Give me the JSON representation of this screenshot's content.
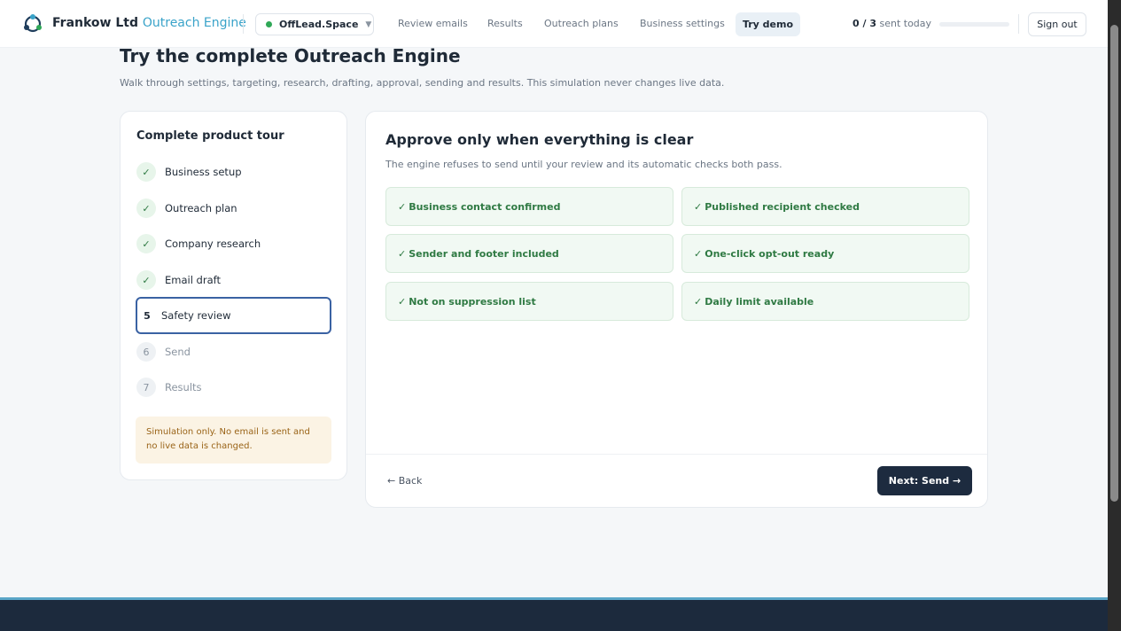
{
  "header": {
    "brand_name": "Frankow Ltd",
    "brand_app": "Outreach Engine",
    "domain": "OffLead.Space",
    "nav": [
      "Review emails",
      "Results",
      "Outreach plans",
      "Business settings"
    ],
    "nav_active": "Try demo",
    "sent_count": "0 / 3",
    "sent_suffix": "sent today",
    "sent_fraction": 0,
    "sign_out": "Sign out",
    "accent_color": "#3aa3c9",
    "status_color": "#2fa857"
  },
  "page": {
    "title": "Try the complete Outreach Engine",
    "subtitle": "Walk through settings, targeting, research, drafting, approval, sending and results. This simulation never changes live data."
  },
  "tour": {
    "title": "Complete product tour",
    "steps": [
      {
        "marker": "✓",
        "label": "Business setup",
        "state": "done"
      },
      {
        "marker": "✓",
        "label": "Outreach plan",
        "state": "done"
      },
      {
        "marker": "✓",
        "label": "Company research",
        "state": "done"
      },
      {
        "marker": "✓",
        "label": "Email draft",
        "state": "done"
      },
      {
        "marker": "5",
        "label": "Safety review",
        "state": "current"
      },
      {
        "marker": "6",
        "label": "Send",
        "state": "pending"
      },
      {
        "marker": "7",
        "label": "Results",
        "state": "pending"
      }
    ],
    "note": "Simulation only. No email is sent and no live data is changed."
  },
  "review": {
    "title": "Approve only when everything is clear",
    "subtitle": "The engine refuses to send until your review and its automatic checks both pass.",
    "checks": [
      "Business contact confirmed",
      "Published recipient checked",
      "Sender and footer included",
      "One-click opt-out ready",
      "Not on suppression list",
      "Daily limit available"
    ],
    "check_mark": "✓",
    "back": "← Back",
    "next": "Next: Send →"
  }
}
